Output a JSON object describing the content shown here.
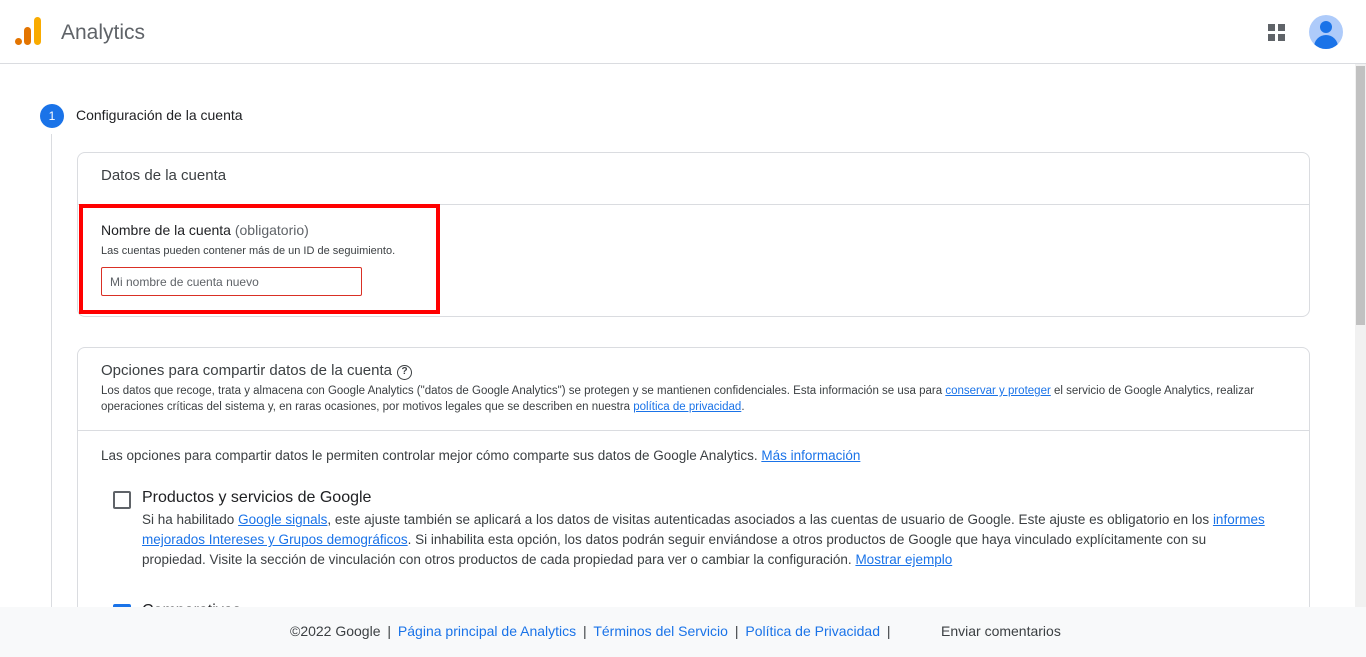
{
  "header": {
    "app_title": "Analytics",
    "apps_icon": "apps-grid-icon",
    "avatar_icon": "account-avatar-icon"
  },
  "step": {
    "number": "1",
    "title": "Configuración de la cuenta"
  },
  "account_card": {
    "title": "Datos de la cuenta",
    "field_label": "Nombre de la cuenta",
    "field_required": "(obligatorio)",
    "field_hint": "Las cuentas pueden contener más de un ID de seguimiento.",
    "field_placeholder": "Mi nombre de cuenta nuevo",
    "field_value": ""
  },
  "sharing_card": {
    "title": "Opciones para compartir datos de la cuenta",
    "help_icon": "help-icon",
    "desc_part1": "Los datos que recoge, trata y almacena con Google Analytics (\"datos de Google Analytics\") se protegen y se mantienen confidenciales. Esta información se usa para ",
    "desc_link1": "conservar y proteger",
    "desc_part2": " el servicio de Google Analytics, realizar operaciones críticas del sistema y, en raras ocasiones, por motivos legales que se describen en nuestra ",
    "desc_link2": "política de privacidad",
    "desc_part3": ".",
    "intro_text": "Las opciones para compartir datos le permiten controlar mejor cómo comparte sus datos de Google Analytics. ",
    "intro_link": "Más información",
    "option1": {
      "title": "Productos y servicios de Google",
      "checked": false,
      "d1": "Si ha habilitado ",
      "l1": "Google signals",
      "d2": ", este ajuste también se aplicará a los datos de visitas autenticadas asociados a las cuentas de usuario de Google. Este ajuste es obligatorio en los ",
      "l2": "informes mejorados Intereses y Grupos demográficos",
      "d3": ". Si inhabilita esta opción, los datos podrán seguir enviándose a otros productos de Google que haya vinculado explícitamente con su propiedad. Visite la sección de vinculación con otros productos de cada propiedad para ver o cambiar la configuración. ",
      "l3": "Mostrar ejemplo"
    },
    "option2": {
      "title": "Comparativas",
      "checked": true
    }
  },
  "footer": {
    "copyright": "©2022 Google",
    "link1": "Página principal de Analytics",
    "link2": "Términos del Servicio",
    "link3": "Política de Privacidad",
    "separator": "|",
    "feedback": "Enviar comentarios"
  },
  "colors": {
    "accent": "#1a73e8",
    "highlight": "#ff0000",
    "error_border": "#d93025"
  }
}
